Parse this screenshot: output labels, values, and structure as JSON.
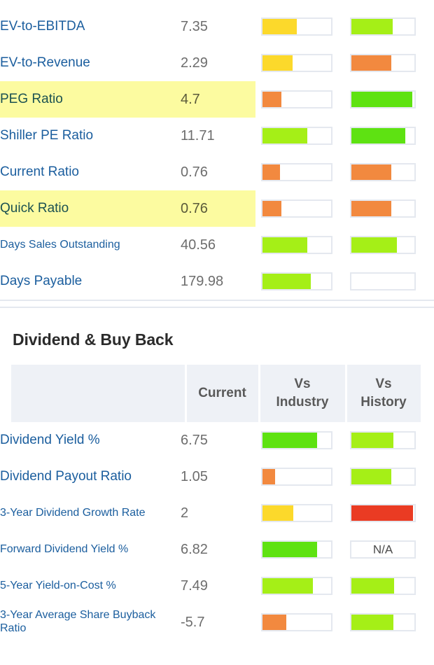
{
  "colors": {
    "label_link": "#1b5e9e",
    "value_text": "#6d6d6d",
    "highlight_bg": "#fcfba0",
    "highlight_text": "#1b5151",
    "bar_border": "#e4e8ef",
    "header_bg": "#eef1f6",
    "header_text": "#595959",
    "heading_text": "#2b2b2b",
    "yellow": "#fcd92b",
    "orange": "#f2893f",
    "yellow_green": "#a5ef17",
    "green": "#5ee212",
    "red": "#ea3b23"
  },
  "valuation_section": {
    "rows": [
      {
        "label": "EV-to-EBITDA",
        "value": "7.35",
        "highlighted": false,
        "label_size": "large",
        "vs_industry": {
          "fill_pct": 50,
          "color": "#fcd92b",
          "na": false
        },
        "vs_history": {
          "fill_pct": 66,
          "color": "#a5ef17",
          "na": false
        }
      },
      {
        "label": "EV-to-Revenue",
        "value": "2.29",
        "highlighted": false,
        "label_size": "large",
        "vs_industry": {
          "fill_pct": 44,
          "color": "#fcd92b",
          "na": false
        },
        "vs_history": {
          "fill_pct": 63,
          "color": "#f2893f",
          "na": false
        }
      },
      {
        "label": "PEG Ratio",
        "value": "4.7",
        "highlighted": true,
        "label_size": "large",
        "vs_industry": {
          "fill_pct": 28,
          "color": "#f2893f",
          "na": false
        },
        "vs_history": {
          "fill_pct": 97,
          "color": "#5ee212",
          "na": false
        }
      },
      {
        "label": "Shiller PE Ratio",
        "value": "11.71",
        "highlighted": false,
        "label_size": "large",
        "vs_industry": {
          "fill_pct": 65,
          "color": "#a5ef17",
          "na": false
        },
        "vs_history": {
          "fill_pct": 85,
          "color": "#5ee212",
          "na": false
        }
      },
      {
        "label": "Current Ratio",
        "value": "0.76",
        "highlighted": false,
        "label_size": "large",
        "vs_industry": {
          "fill_pct": 26,
          "color": "#f2893f",
          "na": false
        },
        "vs_history": {
          "fill_pct": 63,
          "color": "#f2893f",
          "na": false
        }
      },
      {
        "label": "Quick Ratio",
        "value": "0.76",
        "highlighted": true,
        "label_size": "large",
        "vs_industry": {
          "fill_pct": 28,
          "color": "#f2893f",
          "na": false
        },
        "vs_history": {
          "fill_pct": 63,
          "color": "#f2893f",
          "na": false
        }
      },
      {
        "label": "Days Sales Outstanding",
        "value": "40.56",
        "highlighted": false,
        "label_size": "small",
        "vs_industry": {
          "fill_pct": 65,
          "color": "#a5ef17",
          "na": false
        },
        "vs_history": {
          "fill_pct": 72,
          "color": "#a5ef17",
          "na": false
        }
      },
      {
        "label": "Days Payable",
        "value": "179.98",
        "highlighted": false,
        "label_size": "large",
        "vs_industry": {
          "fill_pct": 70,
          "color": "#a5ef17",
          "na": false
        },
        "vs_history": {
          "fill_pct": 0,
          "color": "#a5ef17",
          "na": false
        }
      }
    ]
  },
  "dividend_section": {
    "title": "Dividend & Buy Back",
    "headers": {
      "blank": "",
      "current": "Current",
      "vs_industry_line1": "Vs",
      "vs_industry_line2": "Industry",
      "vs_history_line1": "Vs",
      "vs_history_line2": "History"
    },
    "rows": [
      {
        "label": "Dividend Yield %",
        "value": "6.75",
        "highlighted": false,
        "label_size": "large",
        "vs_industry": {
          "fill_pct": 80,
          "color": "#5ee212",
          "na": false
        },
        "vs_history": {
          "fill_pct": 67,
          "color": "#a5ef17",
          "na": false
        }
      },
      {
        "label": "Dividend Payout Ratio",
        "value": "1.05",
        "highlighted": false,
        "label_size": "large",
        "vs_industry": {
          "fill_pct": 18,
          "color": "#f2893f",
          "na": false
        },
        "vs_history": {
          "fill_pct": 63,
          "color": "#a5ef17",
          "na": false
        }
      },
      {
        "label": "3-Year Dividend Growth Rate",
        "value": "2",
        "highlighted": false,
        "label_size": "wrap",
        "vs_industry": {
          "fill_pct": 45,
          "color": "#fcd92b",
          "na": false
        },
        "vs_history": {
          "fill_pct": 98,
          "color": "#ea3b23",
          "na": false
        }
      },
      {
        "label": "Forward Dividend Yield %",
        "value": "6.82",
        "highlighted": false,
        "label_size": "small",
        "vs_industry": {
          "fill_pct": 80,
          "color": "#5ee212",
          "na": false
        },
        "vs_history": {
          "fill_pct": 0,
          "color": "#a5ef17",
          "na": true,
          "na_text": "N/A"
        }
      },
      {
        "label": "5-Year Yield-on-Cost %",
        "value": "7.49",
        "highlighted": false,
        "label_size": "small",
        "vs_industry": {
          "fill_pct": 73,
          "color": "#a5ef17",
          "na": false
        },
        "vs_history": {
          "fill_pct": 68,
          "color": "#a5ef17",
          "na": false
        }
      },
      {
        "label": "3-Year Average Share Buyback Ratio",
        "value": "-5.7",
        "highlighted": false,
        "label_size": "wrap",
        "vs_industry": {
          "fill_pct": 35,
          "color": "#f2893f",
          "na": false
        },
        "vs_history": {
          "fill_pct": 67,
          "color": "#a5ef17",
          "na": false
        }
      }
    ]
  }
}
